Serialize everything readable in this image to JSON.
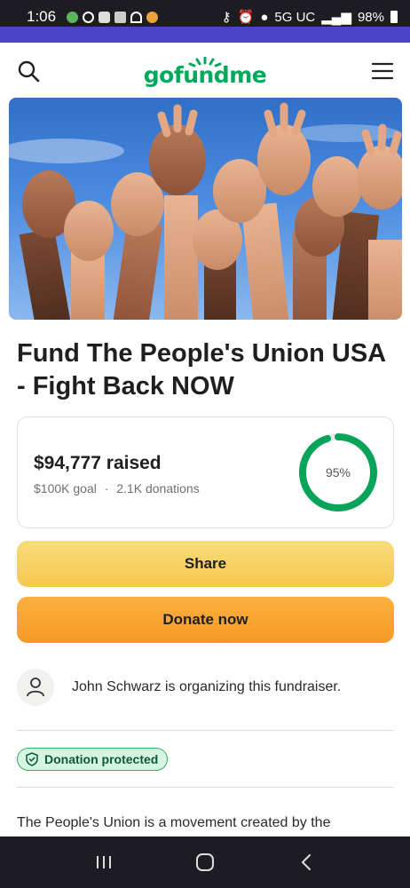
{
  "status_bar": {
    "time": "1:06",
    "network": "5G UC",
    "battery": "98%"
  },
  "header": {
    "logo_text": "gofundme",
    "search_icon": "search-icon",
    "menu_icon": "hamburger-menu-icon"
  },
  "hero": {
    "image_subject": "raised hands against blue sky"
  },
  "campaign": {
    "title": "Fund The People's Union USA - Fight Back NOW"
  },
  "progress": {
    "raised_amount": "$94,777",
    "raised_label": "raised",
    "goal": "$100K goal",
    "separator": "·",
    "donations": "2.1K donations",
    "percent_label": "95%",
    "percent_value": 0.95
  },
  "buttons": {
    "share_label": "Share",
    "donate_label": "Donate now"
  },
  "organizer": {
    "text": "John Schwarz is organizing this fundraiser."
  },
  "badge": {
    "label": "Donation protected"
  },
  "description": {
    "text": "The People's Union is a movement created by the"
  },
  "colors": {
    "brand_green": "#02a95c",
    "share_yellow": "#f5c84e",
    "donate_orange": "#f59a23"
  }
}
